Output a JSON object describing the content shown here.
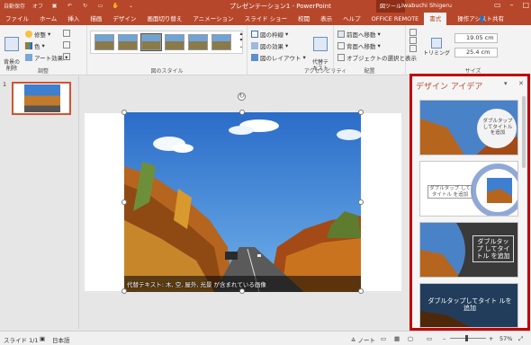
{
  "titlebar": {
    "autosave": "自動保存",
    "autosave_state": "オフ",
    "doc_title": "プレゼンテーション1 - PowerPoint",
    "context_tab": "図ツール",
    "user": "Iwabuchi Shigeru",
    "brand_color": "#b7472a"
  },
  "tabs": [
    {
      "label": "ファイル"
    },
    {
      "label": "ホーム"
    },
    {
      "label": "挿入"
    },
    {
      "label": "描画"
    },
    {
      "label": "デザイン"
    },
    {
      "label": "画面切り替え"
    },
    {
      "label": "アニメーション"
    },
    {
      "label": "スライド ショー"
    },
    {
      "label": "校閲"
    },
    {
      "label": "表示"
    },
    {
      "label": "ヘルプ"
    },
    {
      "label": "OFFICE REMOTE"
    },
    {
      "label": "書式",
      "active": true
    }
  ],
  "tell_me": "操作アシスト",
  "share": "共有",
  "ribbon": {
    "remove_bg": "背景の\n削除",
    "corrections": "修整",
    "color": "色",
    "artistic": "アート効果",
    "group_adjust": "調整",
    "group_styles": "図のスタイル",
    "border": "図の枠線",
    "effects": "図の効果",
    "layout": "図のレイアウト",
    "alt_text": "代替テ\nキスト",
    "group_access": "アクセシビリティ",
    "bring_forward": "前面へ移動",
    "send_backward": "背面へ移動",
    "selection_pane": "オブジェクトの選択と表示",
    "group_arrange": "配置",
    "crop": "トリミング",
    "height": "19.05 cm",
    "width": "25.4 cm",
    "group_size": "サイズ"
  },
  "slides_pane": {
    "slide_number": "1"
  },
  "slide": {
    "alt_text": "代替テキスト: 木, 空, 屋外, 光景 が含まれている画像"
  },
  "design_pane": {
    "title": "デザイン アイデア",
    "ideas": [
      {
        "text": "ダブルタップ してタイトル を追加"
      },
      {
        "text": "ダブルタップ してタイトル を追加"
      },
      {
        "text": "ダブルタップ してタイトル を追加"
      },
      {
        "text": "ダブルタップしてタイト ルを追加"
      }
    ]
  },
  "statusbar": {
    "slide_info": "スライド 1/1",
    "language": "日本語",
    "notes": "ノート",
    "zoom": "57%"
  }
}
